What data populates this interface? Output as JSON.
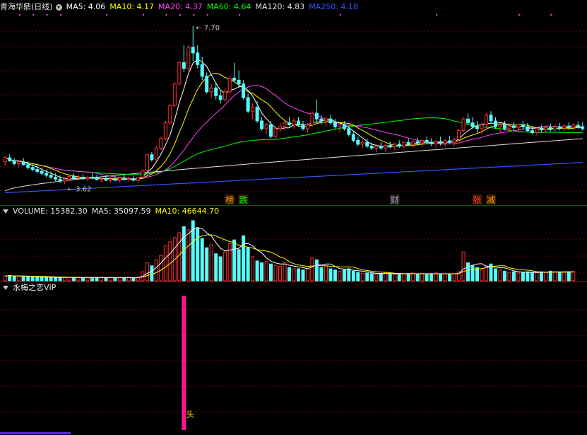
{
  "price_panel": {
    "stock_name": "青海华鼎(日线)",
    "ma": [
      {
        "label": "MA5: 4.06",
        "color": "#ffffff"
      },
      {
        "label": "MA10: 4.17",
        "color": "#ffff00"
      },
      {
        "label": "MA20: 4.37",
        "color": "#ff44ff"
      },
      {
        "label": "MA60: 4.64",
        "color": "#00ff00"
      },
      {
        "label": "MA120: 4.83",
        "color": "#e0e0e0"
      },
      {
        "label": "MA250: 4.18",
        "color": "#3355ff"
      }
    ],
    "high_label": "7.70",
    "low_label": "3.62"
  },
  "volume_panel": {
    "vol_label": "VOLUME: 15382.30",
    "ma5_label": "MA5: 35097.59",
    "ma10_label": "MA10: 46644.70"
  },
  "indicator_panel": {
    "name": "永梅之恋VIP",
    "signal_label": "头"
  },
  "chart_data": {
    "type": "candlestick",
    "up_color": "#ff3232",
    "down_color": "#54fcfc",
    "ylim": [
      3.3,
      8.0
    ],
    "volume_ylim": [
      0,
      100000
    ],
    "events": [
      {
        "label": "榜",
        "color": "#ff9a00",
        "index": 49
      },
      {
        "label": "跌",
        "color": "#00ff00",
        "index": 52
      },
      {
        "label": "财",
        "color": "#66aaff",
        "index": 85
      },
      {
        "label": "张",
        "color": "#ff3333",
        "index": 103
      },
      {
        "label": "减",
        "color": "#ff9a00",
        "index": 106
      }
    ],
    "candles": [
      [
        4.2,
        4.35,
        4.1,
        4.3
      ],
      [
        4.3,
        4.4,
        4.2,
        4.22
      ],
      [
        4.22,
        4.3,
        4.1,
        4.15
      ],
      [
        4.15,
        4.25,
        4.05,
        4.2
      ],
      [
        4.2,
        4.3,
        4.1,
        4.12
      ],
      [
        4.12,
        4.2,
        4.0,
        4.05
      ],
      [
        4.05,
        4.15,
        3.95,
        4.0
      ],
      [
        4.0,
        4.1,
        3.9,
        3.95
      ],
      [
        3.95,
        4.05,
        3.85,
        3.9
      ],
      [
        3.9,
        4.0,
        3.8,
        3.85
      ],
      [
        3.85,
        3.95,
        3.75,
        3.8
      ],
      [
        3.8,
        3.9,
        3.7,
        3.75
      ],
      [
        3.75,
        3.85,
        3.65,
        3.7
      ],
      [
        3.7,
        3.8,
        3.62,
        3.75
      ],
      [
        3.75,
        3.85,
        3.7,
        3.82
      ],
      [
        3.82,
        3.9,
        3.75,
        3.78
      ],
      [
        3.78,
        3.86,
        3.72,
        3.8
      ],
      [
        3.8,
        3.88,
        3.74,
        3.76
      ],
      [
        3.76,
        3.84,
        3.7,
        3.8
      ],
      [
        3.8,
        3.9,
        3.75,
        3.78
      ],
      [
        3.78,
        3.86,
        3.72,
        3.74
      ],
      [
        3.74,
        3.82,
        3.68,
        3.76
      ],
      [
        3.76,
        3.84,
        3.7,
        3.72
      ],
      [
        3.72,
        3.8,
        3.66,
        3.75
      ],
      [
        3.75,
        3.83,
        3.7,
        3.72
      ],
      [
        3.72,
        3.8,
        3.66,
        3.78
      ],
      [
        3.78,
        3.86,
        3.72,
        3.74
      ],
      [
        3.74,
        3.82,
        3.68,
        3.76
      ],
      [
        3.76,
        3.84,
        3.7,
        3.72
      ],
      [
        3.72,
        3.8,
        3.66,
        3.8
      ],
      [
        3.8,
        4.0,
        3.78,
        3.98
      ],
      [
        3.98,
        4.4,
        3.95,
        4.38
      ],
      [
        4.38,
        4.45,
        4.2,
        4.25
      ],
      [
        4.25,
        4.6,
        4.2,
        4.55
      ],
      [
        4.55,
        4.85,
        4.5,
        4.8
      ],
      [
        4.8,
        5.25,
        4.75,
        5.2
      ],
      [
        5.2,
        5.7,
        5.15,
        5.65
      ],
      [
        5.65,
        6.25,
        5.6,
        6.2
      ],
      [
        6.2,
        6.8,
        6.15,
        6.75
      ],
      [
        6.75,
        7.2,
        6.5,
        6.6
      ],
      [
        6.6,
        7.2,
        6.55,
        7.15
      ],
      [
        7.15,
        7.7,
        6.8,
        7.0
      ],
      [
        7.0,
        7.2,
        6.6,
        6.7
      ],
      [
        6.7,
        6.9,
        6.3,
        6.4
      ],
      [
        6.4,
        6.5,
        5.95,
        6.0
      ],
      [
        6.0,
        6.2,
        5.85,
        6.1
      ],
      [
        6.1,
        6.25,
        5.8,
        5.9
      ],
      [
        5.9,
        6.05,
        5.7,
        5.8
      ],
      [
        5.8,
        6.1,
        5.75,
        6.0
      ],
      [
        6.0,
        6.4,
        5.95,
        6.35
      ],
      [
        6.35,
        6.75,
        6.25,
        6.3
      ],
      [
        6.3,
        6.55,
        6.1,
        6.2
      ],
      [
        6.2,
        6.3,
        5.8,
        5.85
      ],
      [
        5.85,
        5.95,
        5.45,
        5.5
      ],
      [
        5.5,
        5.7,
        5.3,
        5.6
      ],
      [
        5.6,
        5.75,
        5.2,
        5.25
      ],
      [
        5.25,
        5.35,
        5.0,
        5.05
      ],
      [
        5.05,
        5.2,
        4.9,
        5.15
      ],
      [
        5.15,
        5.25,
        4.8,
        4.85
      ],
      [
        4.85,
        5.1,
        4.8,
        5.05
      ],
      [
        5.05,
        5.2,
        4.95,
        5.1
      ],
      [
        5.1,
        5.25,
        5.0,
        5.2
      ],
      [
        5.2,
        5.35,
        5.1,
        5.15
      ],
      [
        5.15,
        5.3,
        5.05,
        5.25
      ],
      [
        5.25,
        5.35,
        5.1,
        5.15
      ],
      [
        5.15,
        5.25,
        5.0,
        5.05
      ],
      [
        5.05,
        5.2,
        4.95,
        5.15
      ],
      [
        5.15,
        5.5,
        5.1,
        5.45
      ],
      [
        5.45,
        5.8,
        5.2,
        5.3
      ],
      [
        5.3,
        5.4,
        5.15,
        5.25
      ],
      [
        5.25,
        5.35,
        5.1,
        5.3
      ],
      [
        5.3,
        5.4,
        5.15,
        5.2
      ],
      [
        5.2,
        5.3,
        5.05,
        5.1
      ],
      [
        5.1,
        5.2,
        4.95,
        5.15
      ],
      [
        5.15,
        5.25,
        5.0,
        5.05
      ],
      [
        5.05,
        5.15,
        4.85,
        4.9
      ],
      [
        4.9,
        5.0,
        4.7,
        4.75
      ],
      [
        4.75,
        4.85,
        4.6,
        4.65
      ],
      [
        4.65,
        4.75,
        4.55,
        4.7
      ],
      [
        4.7,
        4.8,
        4.55,
        4.6
      ],
      [
        4.6,
        4.7,
        4.5,
        4.55
      ],
      [
        4.55,
        4.65,
        4.45,
        4.6
      ],
      [
        4.6,
        4.7,
        4.5,
        4.55
      ],
      [
        4.55,
        4.65,
        4.45,
        4.62
      ],
      [
        4.62,
        4.72,
        4.55,
        4.58
      ],
      [
        4.58,
        4.68,
        4.5,
        4.65
      ],
      [
        4.65,
        4.75,
        4.55,
        4.6
      ],
      [
        4.6,
        4.72,
        4.55,
        4.7
      ],
      [
        4.7,
        4.8,
        4.6,
        4.65
      ],
      [
        4.65,
        4.75,
        4.55,
        4.72
      ],
      [
        4.72,
        4.82,
        4.62,
        4.68
      ],
      [
        4.68,
        4.78,
        4.58,
        4.75
      ],
      [
        4.75,
        4.85,
        4.65,
        4.7
      ],
      [
        4.7,
        4.8,
        4.6,
        4.66
      ],
      [
        4.66,
        4.76,
        4.56,
        4.72
      ],
      [
        4.72,
        4.84,
        4.62,
        4.68
      ],
      [
        4.68,
        4.78,
        4.58,
        4.74
      ],
      [
        4.74,
        4.86,
        4.66,
        4.7
      ],
      [
        4.7,
        4.82,
        4.6,
        4.78
      ],
      [
        4.78,
        5.05,
        4.72,
        5.0
      ],
      [
        5.0,
        5.35,
        4.95,
        5.3
      ],
      [
        5.3,
        5.45,
        5.15,
        5.2
      ],
      [
        5.2,
        5.35,
        5.05,
        5.1
      ],
      [
        5.1,
        5.25,
        4.95,
        5.05
      ],
      [
        5.05,
        5.2,
        4.9,
        5.15
      ],
      [
        5.15,
        5.45,
        5.1,
        5.4
      ],
      [
        5.4,
        5.5,
        5.2,
        5.25
      ],
      [
        5.25,
        5.35,
        5.05,
        5.1
      ],
      [
        5.1,
        5.2,
        4.95,
        5.15
      ],
      [
        5.15,
        5.25,
        5.0,
        5.05
      ],
      [
        5.05,
        5.2,
        4.95,
        5.12
      ],
      [
        5.12,
        5.22,
        5.0,
        5.08
      ],
      [
        5.08,
        5.18,
        4.95,
        5.15
      ],
      [
        5.15,
        5.25,
        5.02,
        5.1
      ],
      [
        5.1,
        5.2,
        4.96,
        5.0
      ],
      [
        5.0,
        5.12,
        4.9,
        4.95
      ],
      [
        4.95,
        5.08,
        4.88,
        5.05
      ],
      [
        5.05,
        5.15,
        4.95,
        5.02
      ],
      [
        5.02,
        5.14,
        4.94,
        5.08
      ],
      [
        5.08,
        5.18,
        4.98,
        5.04
      ],
      [
        5.04,
        5.16,
        4.96,
        5.1
      ],
      [
        5.1,
        5.2,
        5.0,
        5.06
      ],
      [
        5.06,
        5.18,
        4.98,
        5.12
      ],
      [
        5.12,
        5.22,
        5.02,
        5.08
      ],
      [
        5.08,
        5.2,
        5.0,
        5.14
      ],
      [
        5.14,
        5.24,
        5.04,
        5.1
      ],
      [
        5.1,
        5.22,
        5.0,
        5.05
      ]
    ],
    "volume": [
      8000,
      9000,
      7500,
      8200,
      7000,
      6800,
      6500,
      6200,
      6000,
      5800,
      5600,
      5400,
      5200,
      5500,
      6000,
      5800,
      5600,
      5500,
      5400,
      5600,
      5500,
      5300,
      5200,
      5400,
      5300,
      5500,
      5400,
      5200,
      5300,
      6000,
      15000,
      30000,
      25000,
      35000,
      42000,
      58000,
      65000,
      72000,
      80000,
      90000,
      85000,
      100000,
      88000,
      70000,
      55000,
      60000,
      45000,
      40000,
      48000,
      62000,
      68000,
      52000,
      75000,
      55000,
      40000,
      33000,
      30000,
      32000,
      28000,
      26000,
      24000,
      30000,
      22000,
      20000,
      20000,
      18000,
      20000,
      38000,
      35000,
      22000,
      25000,
      20000,
      18000,
      16000,
      18000,
      20000,
      16000,
      14000,
      12000,
      13000,
      12000,
      11000,
      12000,
      13000,
      12000,
      11000,
      12000,
      11000,
      12000,
      13000,
      11000,
      12000,
      11000,
      12000,
      13000,
      11000,
      12000,
      11000,
      12000,
      15000,
      48000,
      30000,
      25000,
      22000,
      18000,
      25000,
      28000,
      20000,
      18000,
      16000,
      14000,
      15000,
      13000,
      14000,
      15000,
      13000,
      14000,
      15000,
      14000,
      16000,
      15000,
      14000,
      15000,
      15000,
      15382
    ],
    "indicator_signals": [
      {
        "index": 39,
        "value": 1
      }
    ]
  }
}
